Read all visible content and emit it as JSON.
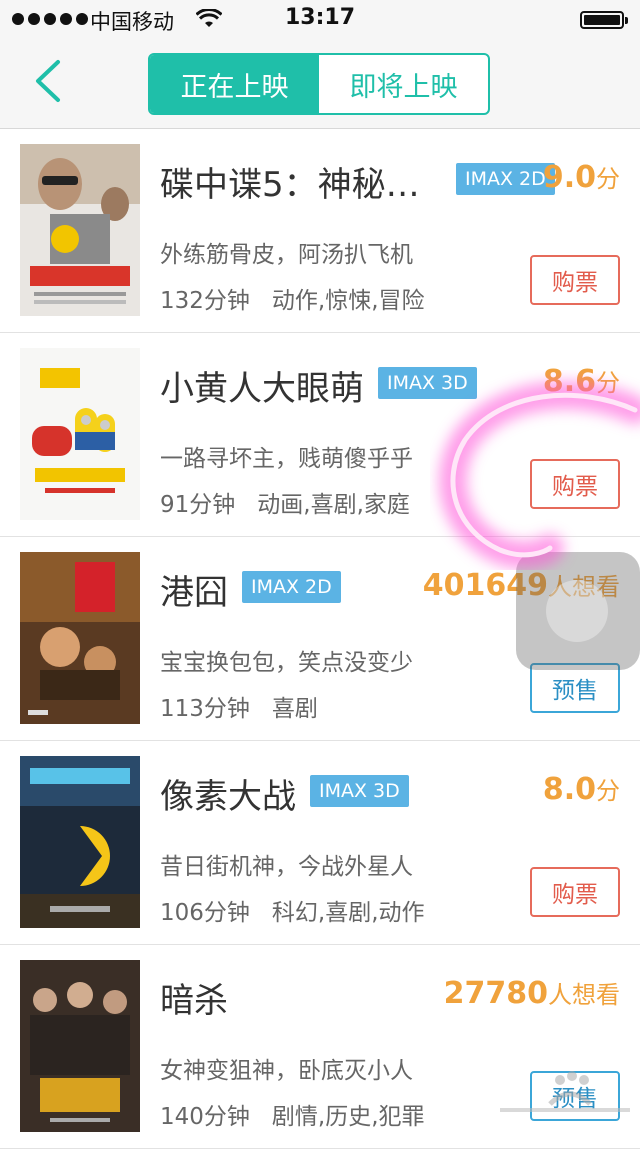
{
  "status_bar": {
    "carrier": "中国移动",
    "time": "13:17"
  },
  "tabs": {
    "now_showing": "正在上映",
    "coming_soon": "即将上映",
    "active": "now_showing",
    "accent_color": "#1fbfa9"
  },
  "colors": {
    "score": "#f0a23c",
    "badge": "#5bb3e4",
    "buy": "#e25c4c",
    "presale": "#2b8fc4"
  },
  "movies": [
    {
      "title": "碟中谍5：神秘…",
      "badge": "IMAX 2D",
      "score_value": "9.0",
      "score_unit": "分",
      "desc": "外练筋骨皮，阿汤扒飞机",
      "duration": "132分钟",
      "genres": "动作,惊悚,冒险",
      "button": "购票",
      "poster_art": "action-poster"
    },
    {
      "title": "小黄人大眼萌",
      "badge": "IMAX 3D",
      "score_value": "8.6",
      "score_unit": "分",
      "desc": "一路寻坏主，贱萌傻乎乎",
      "duration": "91分钟",
      "genres": "动画,喜剧,家庭",
      "button": "购票",
      "poster_art": "minions-poster"
    },
    {
      "title": "港囧",
      "badge": "IMAX 2D",
      "score_value": "401649",
      "score_unit": "人想看",
      "desc": "宝宝换包包，笑点没变少",
      "duration": "113分钟",
      "genres": "喜剧",
      "button": "预售",
      "poster_art": "comedy-poster"
    },
    {
      "title": "像素大战",
      "badge": "IMAX 3D",
      "score_value": "8.0",
      "score_unit": "分",
      "desc": "昔日街机神，今战外星人",
      "duration": "106分钟",
      "genres": "科幻,喜剧,动作",
      "button": "购票",
      "poster_art": "pacman-poster"
    },
    {
      "title": "暗杀",
      "badge": "",
      "score_value": "27780",
      "score_unit": "人想看",
      "desc": "女神变狙神，卧底灭小人",
      "duration": "140分钟",
      "genres": "剧情,历史,犯罪",
      "button": "预售",
      "poster_art": "drama-poster"
    }
  ]
}
